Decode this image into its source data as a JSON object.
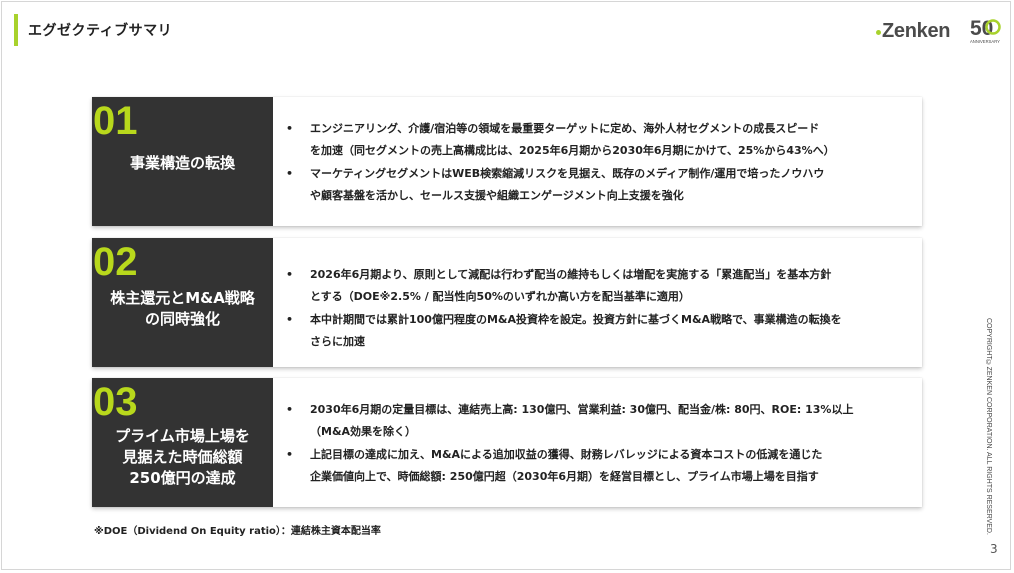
{
  "header": {
    "title": "エグゼクティブサマリ",
    "accent_color": "#a8d22c"
  },
  "logo": {
    "text": "Zenken",
    "anniversary_number": "50",
    "anniversary_label": "ANNIVERSARY"
  },
  "cards": [
    {
      "number": "01",
      "heading_lines": [
        "事業構造の転換"
      ],
      "bullets": [
        {
          "lines": [
            "エンジニアリング、介護/宿泊等の領域を最重要ターゲットに定め、海外人材セグメントの成長スピード",
            "を加速（同セグメントの売上高構成比は、2025年6月期から2030年6月期にかけて、25%から43%へ）"
          ]
        },
        {
          "lines": [
            "マーケティングセグメントはWEB検索縮減リスクを見据え、既存のメディア制作/運用で培ったノウハウ",
            "や顧客基盤を活かし、セールス支援や組織エンゲージメント向上支援を強化"
          ]
        }
      ]
    },
    {
      "number": "02",
      "heading_lines": [
        "株主還元とM&A戦略",
        "の同時強化"
      ],
      "bullets": [
        {
          "lines": [
            "2026年6月期より、原則として減配は行わず配当の維持もしくは増配を実施する「累進配当」を基本方針",
            "とする（DOE※2.5% / 配当性向50%のいずれか高い方を配当基準に適用）"
          ]
        },
        {
          "lines": [
            "本中計期間では累計100億円程度のM&A投資枠を設定。投資方針に基づくM&A戦略で、事業構造の転換を",
            "さらに加速"
          ]
        }
      ]
    },
    {
      "number": "03",
      "heading_lines": [
        "プライム市場上場を",
        "見据えた時価総額",
        "250億円の達成"
      ],
      "bullets": [
        {
          "lines": [
            "2030年6月期の定量目標は、連結売上高: 130億円、営業利益: 30億円、配当金/株: 80円、ROE: 13%以上",
            "（M&A効果を除く）"
          ]
        },
        {
          "lines": [
            "上記目標の達成に加え、M&Aによる追加収益の獲得、財務レバレッジによる資本コストの低減を通じた",
            "企業価値向上で、時価総額: 250億円超（2030年6月期）を経営目標とし、プライム市場上場を目指す"
          ]
        }
      ]
    }
  ],
  "footnote": "※DOE（Dividend On Equity ratio）：連結株主資本配当率",
  "copyright": "COPYRIGHT©ZENKEN CORPORATION. ALL RIGHTS RESERVED.",
  "page_number": "3"
}
